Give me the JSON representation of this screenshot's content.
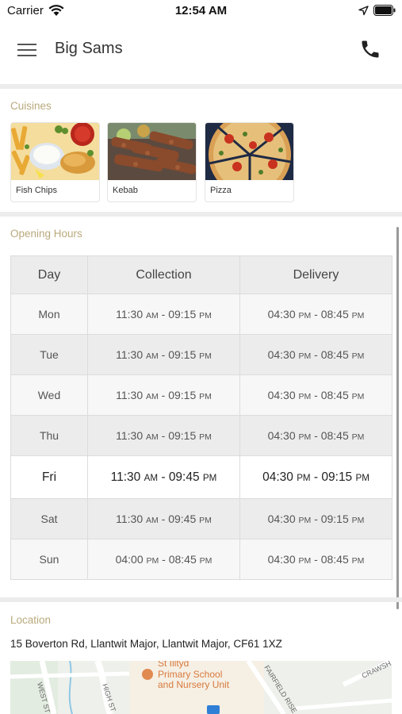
{
  "status_bar": {
    "carrier": "Carrier",
    "time": "12:54 AM"
  },
  "header": {
    "title": "Big Sams",
    "menu_icon": "hamburger-menu-icon",
    "call_icon": "phone-icon"
  },
  "cuisines": {
    "title": "Cuisines",
    "items": [
      {
        "label": "Fish  Chips"
      },
      {
        "label": "Kebab"
      },
      {
        "label": "Pizza"
      }
    ]
  },
  "opening_hours": {
    "title": "Opening Hours",
    "headers": {
      "day": "Day",
      "collection": "Collection",
      "delivery": "Delivery"
    },
    "rows": [
      {
        "day": "Mon",
        "col_start": "11:30",
        "col_start_ampm": "AM",
        "col_end": "09:15",
        "col_end_ampm": "PM",
        "del_start": "04:30",
        "del_start_ampm": "PM",
        "del_end": "08:45",
        "del_end_ampm": "PM"
      },
      {
        "day": "Tue",
        "col_start": "11:30",
        "col_start_ampm": "AM",
        "col_end": "09:15",
        "col_end_ampm": "PM",
        "del_start": "04:30",
        "del_start_ampm": "PM",
        "del_end": "08:45",
        "del_end_ampm": "PM"
      },
      {
        "day": "Wed",
        "col_start": "11:30",
        "col_start_ampm": "AM",
        "col_end": "09:15",
        "col_end_ampm": "PM",
        "del_start": "04:30",
        "del_start_ampm": "PM",
        "del_end": "08:45",
        "del_end_ampm": "PM"
      },
      {
        "day": "Thu",
        "col_start": "11:30",
        "col_start_ampm": "AM",
        "col_end": "09:15",
        "col_end_ampm": "PM",
        "del_start": "04:30",
        "del_start_ampm": "PM",
        "del_end": "08:45",
        "del_end_ampm": "PM"
      },
      {
        "day": "Fri",
        "col_start": "11:30",
        "col_start_ampm": "AM",
        "col_end": "09:45",
        "col_end_ampm": "PM",
        "del_start": "04:30",
        "del_start_ampm": "PM",
        "del_end": "09:15",
        "del_end_ampm": "PM"
      },
      {
        "day": "Sat",
        "col_start": "11:30",
        "col_start_ampm": "AM",
        "col_end": "09:45",
        "col_end_ampm": "PM",
        "del_start": "04:30",
        "del_start_ampm": "PM",
        "del_end": "09:15",
        "del_end_ampm": "PM"
      },
      {
        "day": "Sun",
        "col_start": "04:00",
        "col_start_ampm": "PM",
        "col_end": "08:45",
        "col_end_ampm": "PM",
        "del_start": "04:30",
        "del_start_ampm": "PM",
        "del_end": "08:45",
        "del_end_ampm": "PM"
      }
    ]
  },
  "location": {
    "title": "Location",
    "address": "15 Boverton Rd, Llantwit Major, Llantwit Major, CF61 1XZ",
    "map": {
      "poi_line1": "St Illtyd",
      "poi_line2": "Primary School",
      "poi_line3": "and Nursery Unit",
      "street_west": "WEST ST",
      "street_high": "HIGH ST",
      "street_fairfield": "FAIRFIELD RISE",
      "street_crawshay": "CRAWSH"
    }
  }
}
